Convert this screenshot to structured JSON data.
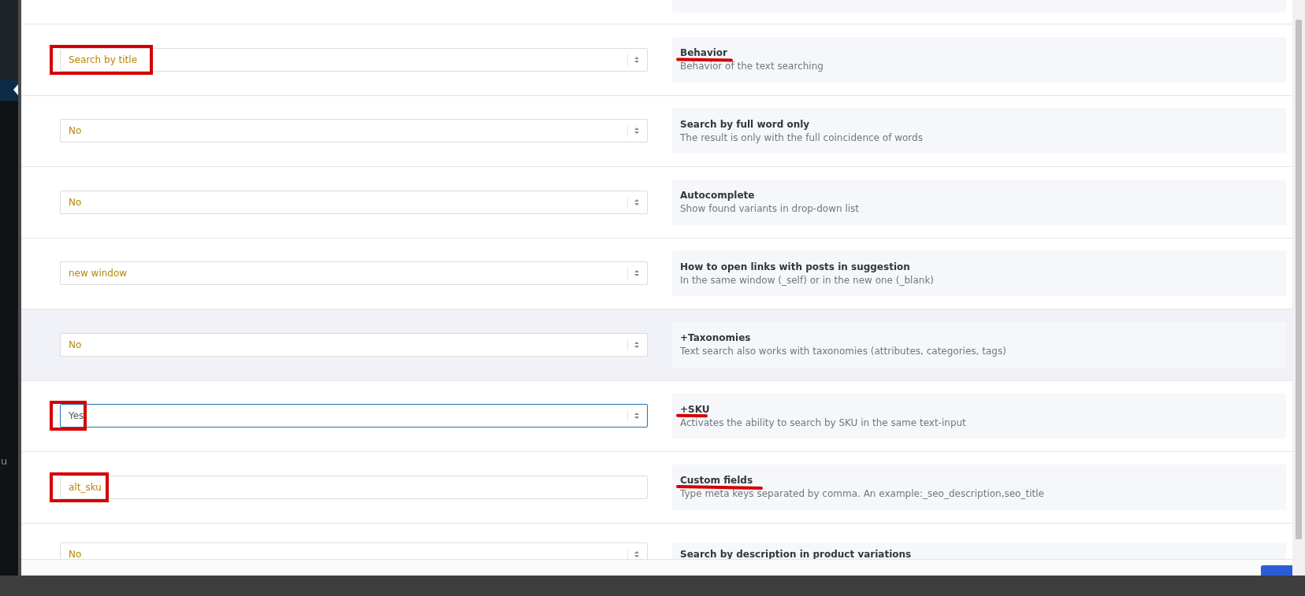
{
  "sidebar": {
    "text": "u"
  },
  "settings": [
    {
      "kind": "select",
      "value": "Search by title",
      "title": "Behavior",
      "description": "Behavior of the text searching",
      "value_marked": true,
      "title_marked": true,
      "focused": false,
      "shaded": false
    },
    {
      "kind": "select",
      "value": "No",
      "title": "Search by full word only",
      "description": "The result is only with the full coincidence of words",
      "value_marked": false,
      "title_marked": false,
      "focused": false,
      "shaded": false
    },
    {
      "kind": "select",
      "value": "No",
      "title": "Autocomplete",
      "description": "Show found variants in drop-down list",
      "value_marked": false,
      "title_marked": false,
      "focused": false,
      "shaded": false
    },
    {
      "kind": "select",
      "value": "new window",
      "title": "How to open links with posts in suggestion",
      "description": "In the same window (_self) or in the new one (_blank)",
      "value_marked": false,
      "title_marked": false,
      "focused": false,
      "shaded": false
    },
    {
      "kind": "select",
      "value": "No",
      "title": "+Taxonomies",
      "description": "Text search also works with taxonomies (attributes, categories, tags)",
      "value_marked": false,
      "title_marked": false,
      "focused": false,
      "shaded": true
    },
    {
      "kind": "select",
      "value": "Yes",
      "title": "+SKU",
      "description": "Activates the ability to search by SKU in the same text-input",
      "value_marked": true,
      "title_marked": true,
      "focused": true,
      "shaded": false
    },
    {
      "kind": "text",
      "value": "alt_sku",
      "title": "Custom fields",
      "description": "Type meta keys separated by comma. An example:_seo_description,seo_title",
      "value_marked": true,
      "title_marked": true,
      "focused": false,
      "shaded": false
    },
    {
      "kind": "select",
      "value": "No",
      "title": "Search by description in product variations",
      "value_marked": false,
      "title_marked": false,
      "focused": false,
      "shaded": false
    }
  ]
}
